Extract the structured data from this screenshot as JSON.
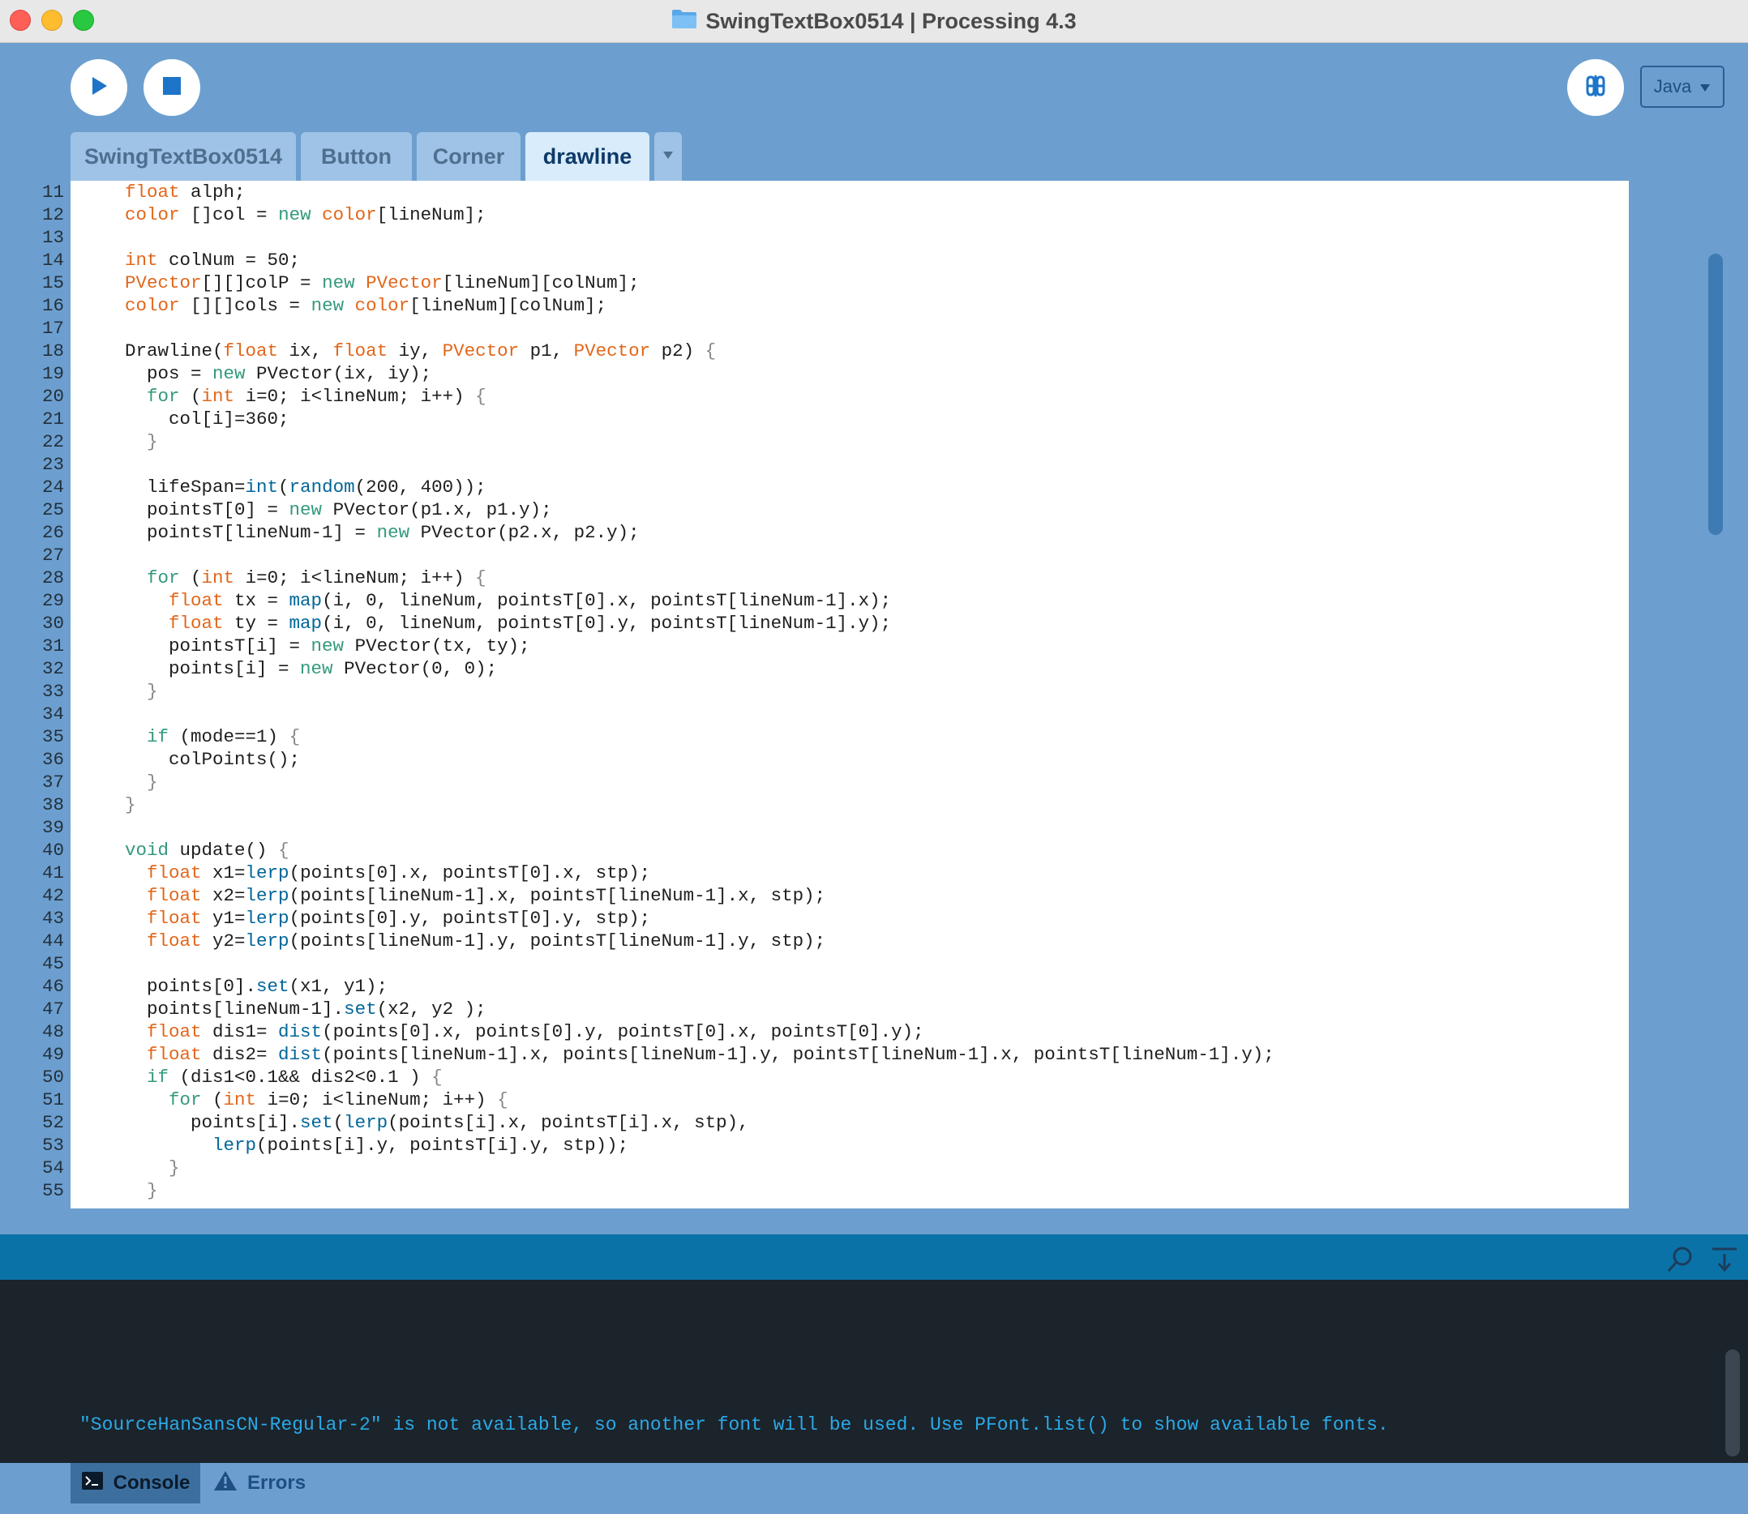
{
  "window": {
    "title": "SwingTextBox0514 | Processing 4.3"
  },
  "toolbar": {
    "mode_label": "Java"
  },
  "tabs": [
    {
      "label": "SwingTextBox0514"
    },
    {
      "label": "Button"
    },
    {
      "label": "Corner"
    },
    {
      "label": "drawline"
    }
  ],
  "editor": {
    "lines": [
      {
        "n": "11",
        "t": [
          [
            "",
            "  "
          ],
          [
            "kw",
            "float"
          ],
          [
            "",
            " alph;"
          ]
        ]
      },
      {
        "n": "12",
        "t": [
          [
            "",
            "  "
          ],
          [
            "kw",
            "color"
          ],
          [
            "",
            " []col = "
          ],
          [
            "nw",
            "new"
          ],
          [
            "",
            " "
          ],
          [
            "kw",
            "color"
          ],
          [
            "",
            "[lineNum];"
          ]
        ]
      },
      {
        "n": "13",
        "t": []
      },
      {
        "n": "14",
        "t": [
          [
            "",
            "  "
          ],
          [
            "kw",
            "int"
          ],
          [
            "",
            " colNum = 50;"
          ]
        ]
      },
      {
        "n": "15",
        "t": [
          [
            "",
            "  "
          ],
          [
            "kw",
            "PVector"
          ],
          [
            "",
            "[][]colP = "
          ],
          [
            "nw",
            "new"
          ],
          [
            "",
            " "
          ],
          [
            "kw",
            "PVector"
          ],
          [
            "",
            "[lineNum][colNum];"
          ]
        ]
      },
      {
        "n": "16",
        "t": [
          [
            "",
            "  "
          ],
          [
            "kw",
            "color"
          ],
          [
            "",
            " [][]cols = "
          ],
          [
            "nw",
            "new"
          ],
          [
            "",
            " "
          ],
          [
            "kw",
            "color"
          ],
          [
            "",
            "[lineNum][colNum];"
          ]
        ]
      },
      {
        "n": "17",
        "t": []
      },
      {
        "n": "18",
        "t": [
          [
            "",
            "  Drawline("
          ],
          [
            "kw",
            "float"
          ],
          [
            "",
            " ix, "
          ],
          [
            "kw",
            "float"
          ],
          [
            "",
            " iy, "
          ],
          [
            "kw",
            "PVector"
          ],
          [
            "",
            " p1, "
          ],
          [
            "kw",
            "PVector"
          ],
          [
            "",
            " p2) "
          ],
          [
            "br",
            "{"
          ]
        ]
      },
      {
        "n": "19",
        "t": [
          [
            "",
            "    pos = "
          ],
          [
            "nw",
            "new"
          ],
          [
            "",
            " PVector(ix, iy);"
          ]
        ]
      },
      {
        "n": "20",
        "t": [
          [
            "",
            "    "
          ],
          [
            "nw",
            "for"
          ],
          [
            "",
            " ("
          ],
          [
            "kw",
            "int"
          ],
          [
            "",
            " i=0; i<lineNum; i++) "
          ],
          [
            "br",
            "{"
          ]
        ]
      },
      {
        "n": "21",
        "t": [
          [
            "",
            "      col[i]=360;"
          ]
        ]
      },
      {
        "n": "22",
        "t": [
          [
            "",
            "    "
          ],
          [
            "br",
            "}"
          ]
        ]
      },
      {
        "n": "23",
        "t": []
      },
      {
        "n": "24",
        "t": [
          [
            "",
            "    lifeSpan="
          ],
          [
            "fn",
            "int"
          ],
          [
            "",
            "("
          ],
          [
            "fn",
            "random"
          ],
          [
            "",
            "(200, 400));"
          ]
        ]
      },
      {
        "n": "25",
        "t": [
          [
            "",
            "    pointsT[0] = "
          ],
          [
            "nw",
            "new"
          ],
          [
            "",
            " PVector(p1.x, p1.y);"
          ]
        ]
      },
      {
        "n": "26",
        "t": [
          [
            "",
            "    pointsT[lineNum-1] = "
          ],
          [
            "nw",
            "new"
          ],
          [
            "",
            " PVector(p2.x, p2.y);"
          ]
        ]
      },
      {
        "n": "27",
        "t": []
      },
      {
        "n": "28",
        "t": [
          [
            "",
            "    "
          ],
          [
            "nw",
            "for"
          ],
          [
            "",
            " ("
          ],
          [
            "kw",
            "int"
          ],
          [
            "",
            " i=0; i<lineNum; i++) "
          ],
          [
            "br",
            "{"
          ]
        ]
      },
      {
        "n": "29",
        "t": [
          [
            "",
            "      "
          ],
          [
            "kw",
            "float"
          ],
          [
            "",
            " tx = "
          ],
          [
            "fn",
            "map"
          ],
          [
            "",
            "(i, 0, lineNum, pointsT[0].x, pointsT[lineNum-1].x);"
          ]
        ]
      },
      {
        "n": "30",
        "t": [
          [
            "",
            "      "
          ],
          [
            "kw",
            "float"
          ],
          [
            "",
            " ty = "
          ],
          [
            "fn",
            "map"
          ],
          [
            "",
            "(i, 0, lineNum, pointsT[0].y, pointsT[lineNum-1].y);"
          ]
        ]
      },
      {
        "n": "31",
        "t": [
          [
            "",
            "      pointsT[i] = "
          ],
          [
            "nw",
            "new"
          ],
          [
            "",
            " PVector(tx, ty);"
          ]
        ]
      },
      {
        "n": "32",
        "t": [
          [
            "",
            "      points[i] = "
          ],
          [
            "nw",
            "new"
          ],
          [
            "",
            " PVector(0, 0);"
          ]
        ]
      },
      {
        "n": "33",
        "t": [
          [
            "",
            "    "
          ],
          [
            "br",
            "}"
          ]
        ]
      },
      {
        "n": "34",
        "t": []
      },
      {
        "n": "35",
        "t": [
          [
            "",
            "    "
          ],
          [
            "nw",
            "if"
          ],
          [
            "",
            " (mode==1) "
          ],
          [
            "br",
            "{"
          ]
        ]
      },
      {
        "n": "36",
        "t": [
          [
            "",
            "      colPoints();"
          ]
        ]
      },
      {
        "n": "37",
        "t": [
          [
            "",
            "    "
          ],
          [
            "br",
            "}"
          ]
        ]
      },
      {
        "n": "38",
        "t": [
          [
            "",
            "  "
          ],
          [
            "br",
            "}"
          ]
        ]
      },
      {
        "n": "39",
        "t": []
      },
      {
        "n": "40",
        "t": [
          [
            "",
            "  "
          ],
          [
            "nw",
            "void"
          ],
          [
            "",
            " update() "
          ],
          [
            "br",
            "{"
          ]
        ]
      },
      {
        "n": "41",
        "t": [
          [
            "",
            "    "
          ],
          [
            "kw",
            "float"
          ],
          [
            "",
            " x1="
          ],
          [
            "fn",
            "lerp"
          ],
          [
            "",
            "(points[0].x, pointsT[0].x, stp);"
          ]
        ]
      },
      {
        "n": "42",
        "t": [
          [
            "",
            "    "
          ],
          [
            "kw",
            "float"
          ],
          [
            "",
            " x2="
          ],
          [
            "fn",
            "lerp"
          ],
          [
            "",
            "(points[lineNum-1].x, pointsT[lineNum-1].x, stp);"
          ]
        ]
      },
      {
        "n": "43",
        "t": [
          [
            "",
            "    "
          ],
          [
            "kw",
            "float"
          ],
          [
            "",
            " y1="
          ],
          [
            "fn",
            "lerp"
          ],
          [
            "",
            "(points[0].y, pointsT[0].y, stp);"
          ]
        ]
      },
      {
        "n": "44",
        "t": [
          [
            "",
            "    "
          ],
          [
            "kw",
            "float"
          ],
          [
            "",
            " y2="
          ],
          [
            "fn",
            "lerp"
          ],
          [
            "",
            "(points[lineNum-1].y, pointsT[lineNum-1].y, stp);"
          ]
        ]
      },
      {
        "n": "45",
        "t": []
      },
      {
        "n": "46",
        "t": [
          [
            "",
            "    points[0]."
          ],
          [
            "fn",
            "set"
          ],
          [
            "",
            "(x1, y1);"
          ]
        ]
      },
      {
        "n": "47",
        "t": [
          [
            "",
            "    points[lineNum-1]."
          ],
          [
            "fn",
            "set"
          ],
          [
            "",
            "(x2, y2 );"
          ]
        ]
      },
      {
        "n": "48",
        "t": [
          [
            "",
            "    "
          ],
          [
            "kw",
            "float"
          ],
          [
            "",
            " dis1= "
          ],
          [
            "fn",
            "dist"
          ],
          [
            "",
            "(points[0].x, points[0].y, pointsT[0].x, pointsT[0].y);"
          ]
        ]
      },
      {
        "n": "49",
        "t": [
          [
            "",
            "    "
          ],
          [
            "kw",
            "float"
          ],
          [
            "",
            " dis2= "
          ],
          [
            "fn",
            "dist"
          ],
          [
            "",
            "(points[lineNum-1].x, points[lineNum-1].y, pointsT[lineNum-1].x, pointsT[lineNum-1].y);"
          ]
        ]
      },
      {
        "n": "50",
        "t": [
          [
            "",
            "    "
          ],
          [
            "nw",
            "if"
          ],
          [
            "",
            " (dis1<0.1&& dis2<0.1 ) "
          ],
          [
            "br",
            "{"
          ]
        ]
      },
      {
        "n": "51",
        "t": [
          [
            "",
            "      "
          ],
          [
            "nw",
            "for"
          ],
          [
            "",
            " ("
          ],
          [
            "kw",
            "int"
          ],
          [
            "",
            " i=0; i<lineNum; i++) "
          ],
          [
            "br",
            "{"
          ]
        ]
      },
      {
        "n": "52",
        "t": [
          [
            "",
            "        points[i]."
          ],
          [
            "fn",
            "set"
          ],
          [
            "",
            "("
          ],
          [
            "fn",
            "lerp"
          ],
          [
            "",
            "(points[i].x, pointsT[i].x, stp),"
          ]
        ]
      },
      {
        "n": "53",
        "t": [
          [
            "",
            "          "
          ],
          [
            "fn",
            "lerp"
          ],
          [
            "",
            "(points[i].y, pointsT[i].y, stp));"
          ]
        ]
      },
      {
        "n": "54",
        "t": [
          [
            "",
            "      "
          ],
          [
            "br",
            "}"
          ]
        ]
      },
      {
        "n": "55",
        "t": [
          [
            "",
            "    "
          ],
          [
            "br",
            "}"
          ]
        ]
      }
    ]
  },
  "console": {
    "message": "\"SourceHanSansCN-Regular-2\" is not available, so another font will be used. Use PFont.list() to show available fonts."
  },
  "bottom_tabs": {
    "console_label": "Console",
    "errors_label": "Errors"
  },
  "colors": {
    "keyword": "#e2661a",
    "function": "#006699",
    "builtin": "#33997e",
    "chrome_blue": "#6c9fcf",
    "console_bg": "#1b232b",
    "console_text": "#2ba9e6"
  },
  "icons": [
    "folder-icon",
    "play-icon",
    "stop-icon",
    "debug-icon",
    "chevron-down-icon",
    "search-icon",
    "clear-console-icon",
    "terminal-icon",
    "warning-icon"
  ]
}
